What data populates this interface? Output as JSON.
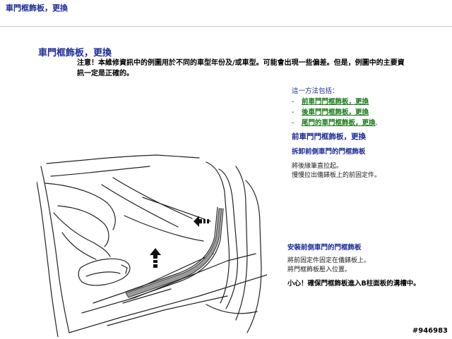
{
  "header": {
    "title": "車門框飾板，更換"
  },
  "main": {
    "title": "車門框飾板，更換",
    "note": "注意！本維修資訊中的例圖用於不同的車型年份及/或車型。可能會出現一些偏差。但是，例圖中的主要資訊一定是正確的。"
  },
  "methods": {
    "intro": "這一方法包括：",
    "links": [
      {
        "label": "前車門門框飾板，更換"
      },
      {
        "label": "後車門門框飾板，更換"
      },
      {
        "label": "尾門的車門框飾板，更換"
      }
    ]
  },
  "section": {
    "title": "前車門門框飾板，更換",
    "remove_title": "拆卸前側車門的門框飾板",
    "remove_steps": [
      "將後緣筆直拉起。",
      "慢慢拉出儀錶板上的前固定件。"
    ],
    "install_title": "安裝前側車門的門框飾板",
    "install_steps": [
      "將前固定件固定在儀錶板上。",
      "將門框飾板壓入位置。"
    ],
    "caution": "小心！確保門框飾板進入B柱面板的溝槽中。"
  },
  "figure": {
    "ref": "#946983"
  }
}
